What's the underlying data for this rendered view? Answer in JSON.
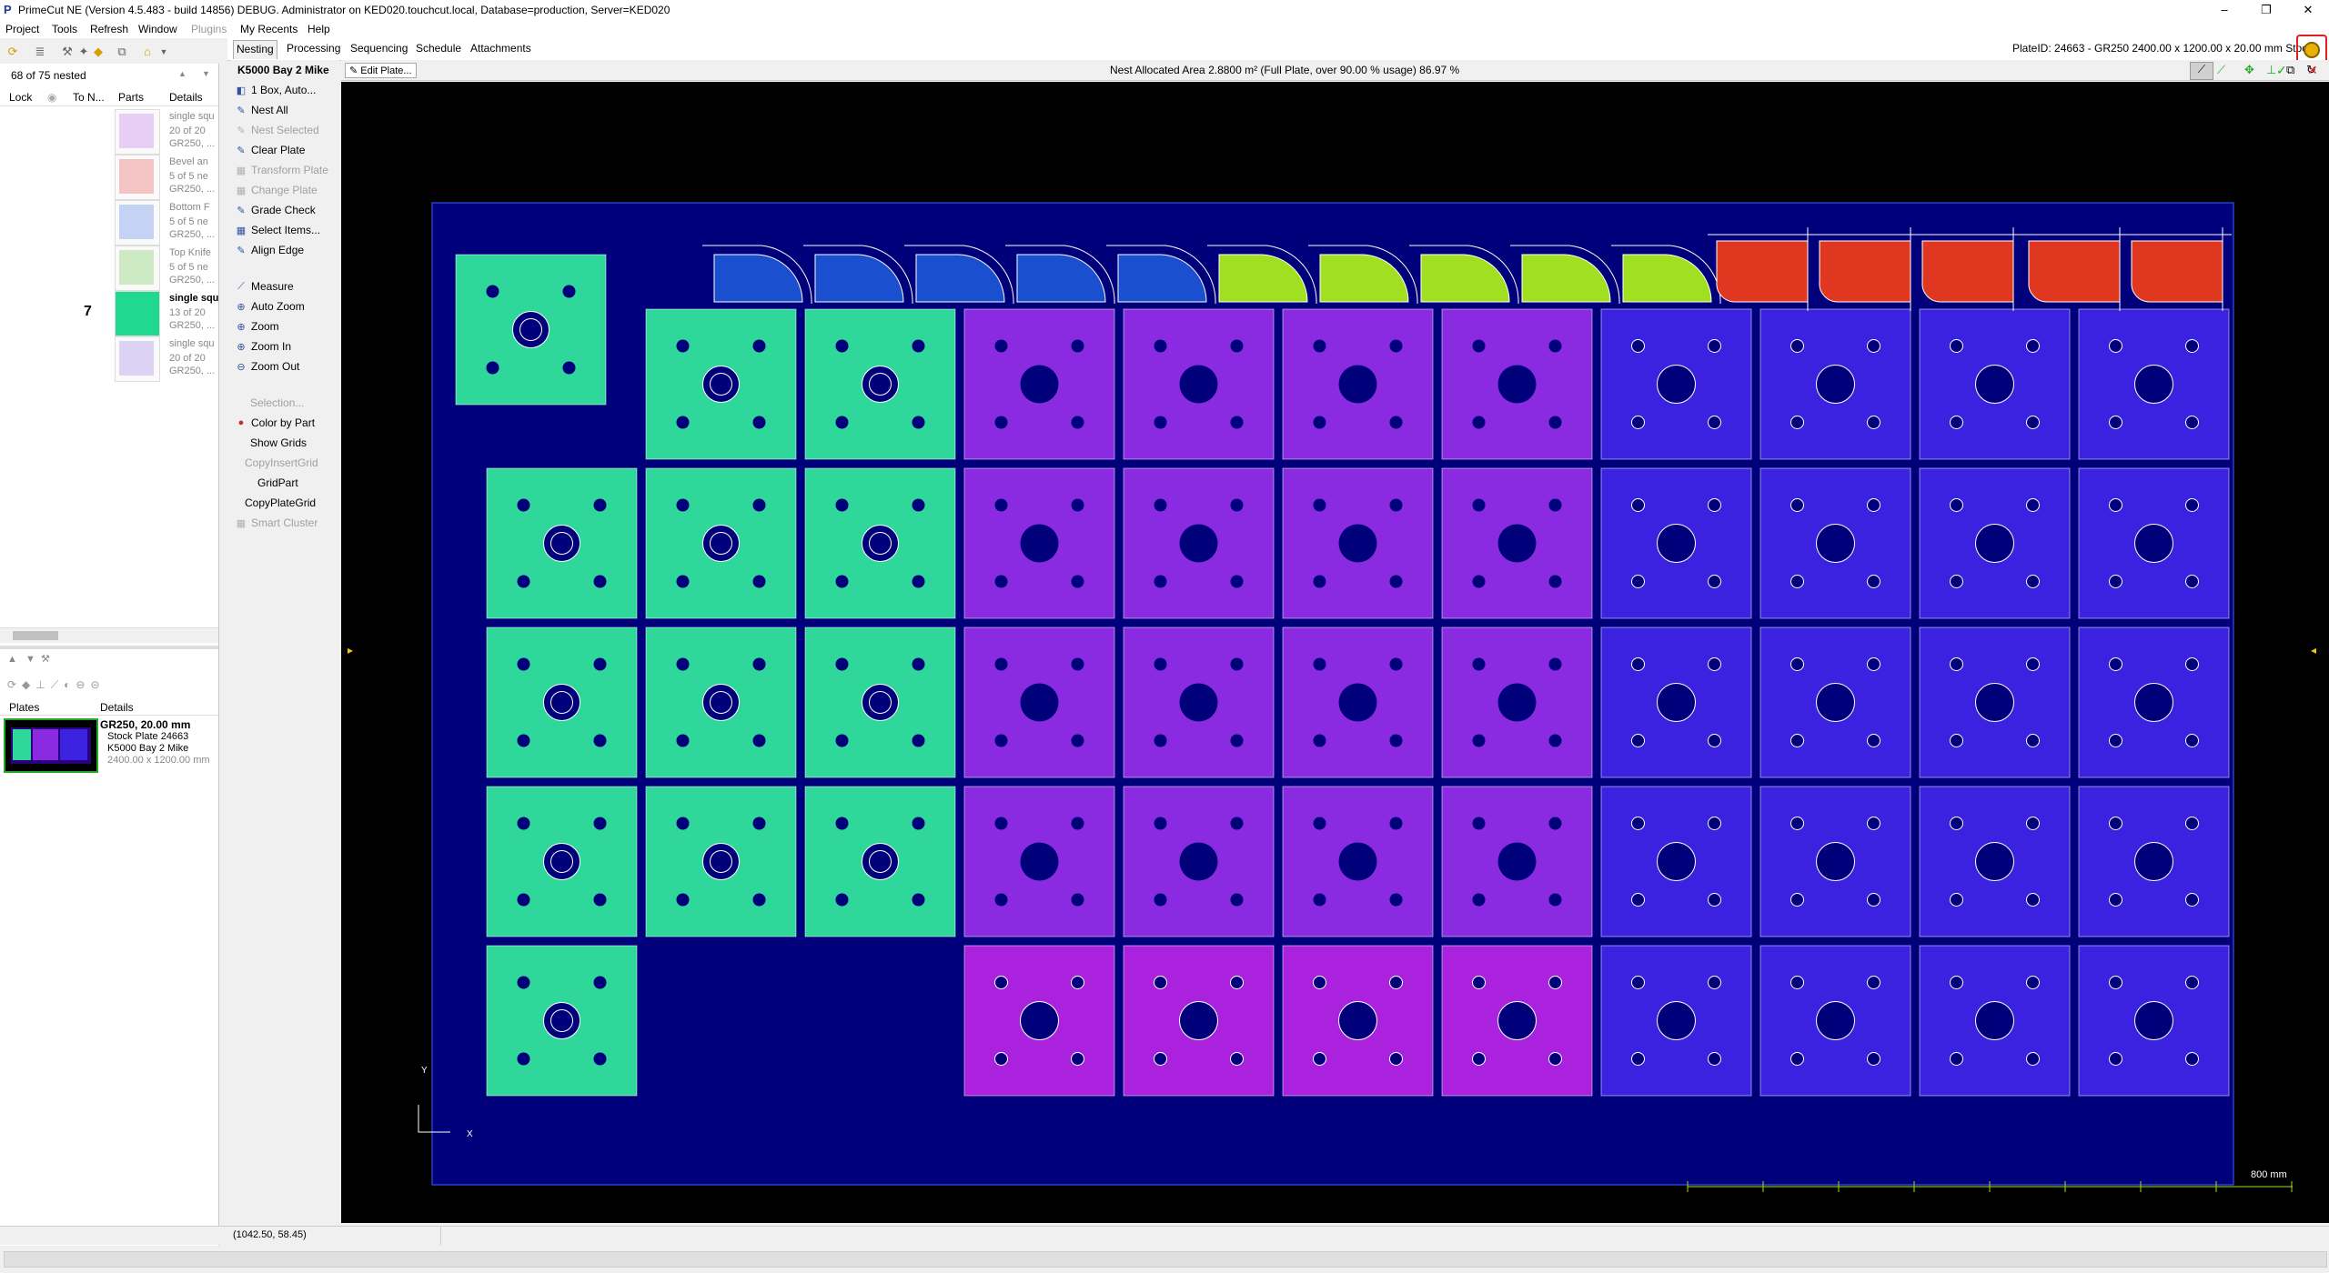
{
  "window": {
    "title": "PrimeCut NE (Version 4.5.483 - build 14856) DEBUG. Administrator on KED020.touchcut.local, Database=production, Server=KED020",
    "minimize": "–",
    "restore": "❐",
    "close": "✕"
  },
  "menu": [
    "Project",
    "Tools",
    "Refresh",
    "Window",
    "Plugins",
    "My Recents",
    "Help"
  ],
  "parts_panel": {
    "count_label": "68 of 75 nested",
    "columns": [
      "Lock",
      "To N...",
      "Parts",
      "Details"
    ],
    "items": [
      {
        "title": "single squ",
        "line1": "20 of 20",
        "line2": "GR250, ...",
        "todo": "",
        "selected": false
      },
      {
        "title": "Bevel an",
        "line1": "5 of 5 ne",
        "line2": "GR250, ...",
        "todo": "",
        "selected": false
      },
      {
        "title": "Bottom F",
        "line1": "5 of 5 ne",
        "line2": "GR250, ...",
        "todo": "",
        "selected": false
      },
      {
        "title": "Top Knife",
        "line1": "5 of 5 ne",
        "line2": "GR250, ...",
        "todo": "",
        "selected": false
      },
      {
        "title": "single squ",
        "line1": "13 of 20",
        "line2": "GR250, ...",
        "todo": "7",
        "selected": true
      },
      {
        "title": "single squ",
        "line1": "20 of 20",
        "line2": "GR250, ...",
        "todo": "",
        "selected": false
      }
    ]
  },
  "plates_panel": {
    "columns": [
      "Plates",
      "Details"
    ],
    "plate": {
      "title": "GR250, 20.00 mm",
      "line1": "Stock Plate 24663",
      "line2": "K5000 Bay 2 Mike",
      "line3": "2400.00 x 1200.00 mm"
    }
  },
  "tabs": [
    "Nesting",
    "Processing",
    "Sequencing",
    "Schedule",
    "Attachments"
  ],
  "plate_info": "PlateID: 24663 - GR250 2400.00 x 1200.00 x 20.00 mm Stock",
  "machine": "K5000 Bay 2 Mike",
  "edit_plate": "Edit Plate...",
  "nest_info": "Nest Allocated Area 2.8800 m² (Full Plate, over 90.00 % usage) 86.97 %",
  "tools": [
    {
      "label": "1 Box, Auto...",
      "icon": "◧",
      "enabled": true
    },
    {
      "label": "Nest All",
      "icon": "✎",
      "enabled": true
    },
    {
      "label": "Nest Selected",
      "icon": "✎",
      "enabled": false
    },
    {
      "label": "Clear Plate",
      "icon": "✎",
      "enabled": true
    },
    {
      "label": "Transform Plate",
      "icon": "▦",
      "enabled": false
    },
    {
      "label": "Change Plate",
      "icon": "▦",
      "enabled": false
    },
    {
      "label": "Grade Check",
      "icon": "✎",
      "enabled": true
    },
    {
      "label": "Select Items...",
      "icon": "▦",
      "enabled": true
    },
    {
      "label": "Align Edge",
      "icon": "✎",
      "enabled": true
    },
    {
      "label": "Measure",
      "icon": "⟋",
      "enabled": true
    },
    {
      "label": "Auto Zoom",
      "icon": "⊕",
      "enabled": true
    },
    {
      "label": "Zoom",
      "icon": "⊕",
      "enabled": true
    },
    {
      "label": "Zoom In",
      "icon": "⊕",
      "enabled": true
    },
    {
      "label": "Zoom Out",
      "icon": "⊖",
      "enabled": true
    },
    {
      "label": "Selection...",
      "icon": "",
      "enabled": false
    },
    {
      "label": "Color by Part",
      "icon": "●",
      "enabled": true
    },
    {
      "label": "Show Grids",
      "icon": "",
      "enabled": true
    },
    {
      "label": "CopyInsertGrid",
      "icon": "",
      "enabled": false
    },
    {
      "label": "GridPart",
      "icon": "",
      "enabled": true
    },
    {
      "label": "CopyPlateGrid",
      "icon": "",
      "enabled": true
    },
    {
      "label": "Smart Cluster",
      "icon": "▦",
      "enabled": false
    }
  ],
  "canvas": {
    "scale_label": "800 mm",
    "axis_y": "Y",
    "axis_x": "X",
    "colors": {
      "plate": "#00007a",
      "teal": "#2fd89a",
      "purple": "#8a2be2",
      "magenta": "#aa22dd",
      "blue": "#3a22e0",
      "elbow_blue": "#1a4fd0",
      "elbow_green": "#a0e020",
      "elbow_red": "#e03820"
    }
  },
  "status": {
    "coords": "(1042.50, 58.45)"
  }
}
